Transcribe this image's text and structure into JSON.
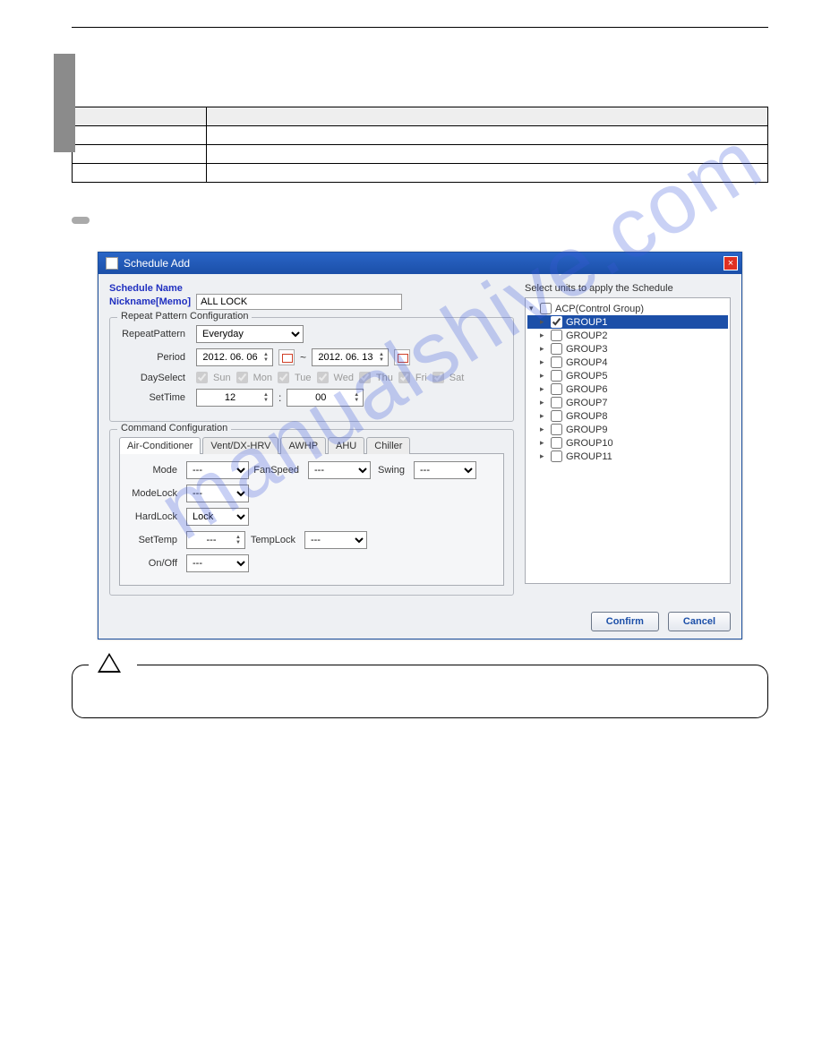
{
  "watermark": "manualshive.com",
  "table": {
    "headers": [
      "",
      ""
    ],
    "rows": [
      [
        "",
        ""
      ],
      [
        "",
        ""
      ],
      [
        "",
        ""
      ]
    ]
  },
  "notes_label": "",
  "notes_text": "",
  "dialog": {
    "title": "Schedule Add",
    "schedule_name_label": "Schedule Name",
    "nickname_label": "Nickname[Memo]",
    "nickname_value": "ALL LOCK",
    "repeat_section": "Repeat Pattern Configuration",
    "repeat_pattern_label": "RepeatPattern",
    "repeat_pattern_value": "Everyday",
    "period_label": "Period",
    "period_from": "2012. 06. 06",
    "period_sep": "~",
    "period_to": "2012. 06. 13",
    "dayselect_label": "DaySelect",
    "days": [
      "Sun",
      "Mon",
      "Tue",
      "Wed",
      "Thu",
      "Fri",
      "Sat"
    ],
    "settime_label": "SetTime",
    "settime_hour": "12",
    "settime_colon": ":",
    "settime_min": "00",
    "command_section": "Command Configuration",
    "tabs": [
      "Air-Conditioner",
      "Vent/DX-HRV",
      "AWHP",
      "AHU",
      "Chiller"
    ],
    "cmd": {
      "mode": "Mode",
      "mode_val": "---",
      "fanspeed": "FanSpeed",
      "fanspeed_val": "---",
      "swing": "Swing",
      "swing_val": "---",
      "modelock": "ModeLock",
      "modelock_val": "---",
      "hardlock": "HardLock",
      "hardlock_val": "Lock",
      "settemp": "SetTemp",
      "settemp_val": "---",
      "templock": "TempLock",
      "templock_val": "---",
      "onoff": "On/Off",
      "onoff_val": "---"
    },
    "tree_label": "Select units to apply the Schedule",
    "tree_root": "ACP(Control Group)",
    "tree_items": [
      "GROUP1",
      "GROUP2",
      "GROUP3",
      "GROUP4",
      "GROUP5",
      "GROUP6",
      "GROUP7",
      "GROUP8",
      "GROUP9",
      "GROUP10",
      "GROUP11"
    ],
    "tree_selected_index": 0,
    "confirm": "Confirm",
    "cancel": "Cancel"
  },
  "caution_head": "",
  "caution_p1": "",
  "caution_p2": ""
}
